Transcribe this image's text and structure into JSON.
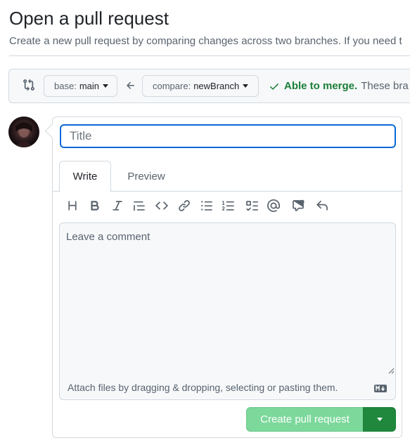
{
  "header": {
    "title": "Open a pull request",
    "description": "Create a new pull request by comparing changes across two branches. If you need t"
  },
  "range": {
    "base_label": "base:",
    "base_branch": "main",
    "compare_label": "compare:",
    "compare_branch": "newBranch",
    "merge_status": "Able to merge.",
    "merge_status_rest": "These bra"
  },
  "form": {
    "title_placeholder": "Title",
    "tabs": [
      {
        "label": "Write"
      },
      {
        "label": "Preview"
      }
    ],
    "toolbar_icons": [
      "heading-icon",
      "bold-icon",
      "italic-icon",
      "quote-icon",
      "code-icon",
      "link-icon",
      "unordered-list-icon",
      "ordered-list-icon",
      "task-list-icon",
      "mention-icon",
      "cross-reference-icon",
      "undo-icon"
    ],
    "comment_placeholder": "Leave a comment",
    "attach_text": "Attach files by dragging & dropping, selecting or pasting them.",
    "submit_label": "Create pull request"
  },
  "colors": {
    "accent_blue": "#0969da",
    "success_green": "#1a7f37",
    "button_green_disabled": "#7cd89b",
    "button_green": "#1f883d"
  }
}
